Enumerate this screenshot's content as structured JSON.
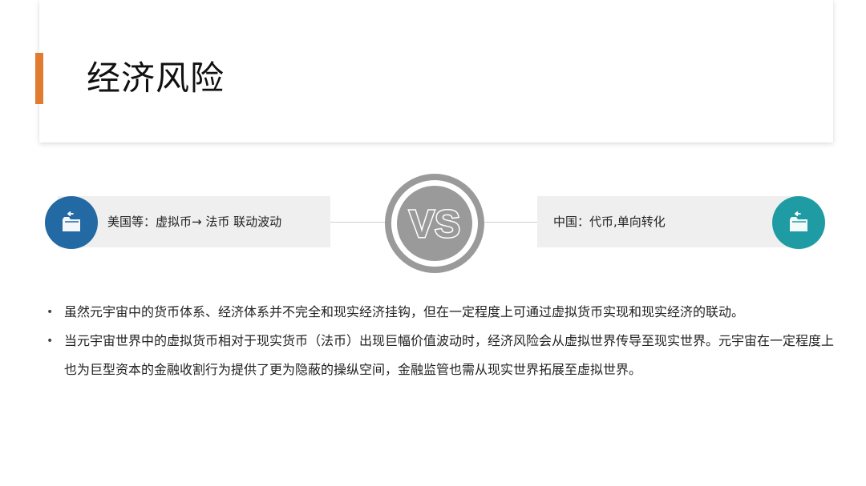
{
  "slide": {
    "title": "经济风险"
  },
  "comparison": {
    "left": {
      "text": "美国等：虚拟币→ 法币 联动波动",
      "icon": "folder-icon",
      "color": "#2369a4"
    },
    "vs_label": "VS",
    "right": {
      "text": "中国：代币,单向转化",
      "icon": "folder-icon",
      "color": "#1f9ca3"
    }
  },
  "bullets": [
    "虽然元宇宙中的货币体系、经济体系并不完全和现实经济挂钩，但在一定程度上可通过虚拟货币实现和现实经济的联动。",
    "当元宇宙世界中的虚拟货币相对于现实货币（法币）出现巨幅价值波动时，经济风险会从虚拟世界传导至现实世界。元宇宙在一定程度上也为巨型资本的金融收割行为提供了更为隐蔽的操纵空间，金融监管也需从现实世界拓展至虚拟世界。"
  ],
  "colors": {
    "accent": "#e07b2f",
    "vs_gray": "#9a9a9a"
  }
}
